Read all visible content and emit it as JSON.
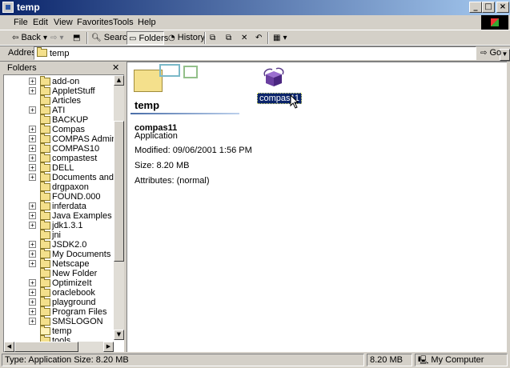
{
  "window": {
    "title": "temp"
  },
  "menu": [
    "File",
    "Edit",
    "View",
    "Favorites",
    "Tools",
    "Help"
  ],
  "toolbar": {
    "back_label": "Back",
    "search_label": "Search",
    "folders_label": "Folders",
    "history_label": "History"
  },
  "address": {
    "label": "Address",
    "value": "temp",
    "go_label": "Go"
  },
  "folders_pane": {
    "title": "Folders",
    "items": [
      {
        "label": "add-on",
        "expandable": true
      },
      {
        "label": "AppletStuff",
        "expandable": true
      },
      {
        "label": "Articles",
        "expandable": false
      },
      {
        "label": "ATI",
        "expandable": true
      },
      {
        "label": "BACKUP",
        "expandable": false
      },
      {
        "label": "Compas",
        "expandable": true
      },
      {
        "label": "COMPAS Administration",
        "expandable": true
      },
      {
        "label": "COMPAS10",
        "expandable": true
      },
      {
        "label": "compastest",
        "expandable": true
      },
      {
        "label": "DELL",
        "expandable": true
      },
      {
        "label": "Documents and Settings",
        "expandable": true
      },
      {
        "label": "drgpaxon",
        "expandable": false
      },
      {
        "label": "FOUND.000",
        "expandable": false
      },
      {
        "label": "inferdata",
        "expandable": true
      },
      {
        "label": "Java Examples",
        "expandable": true
      },
      {
        "label": "jdk1.3.1",
        "expandable": true
      },
      {
        "label": "jni",
        "expandable": false
      },
      {
        "label": "JSDK2.0",
        "expandable": true
      },
      {
        "label": "My Documents",
        "expandable": true
      },
      {
        "label": "Netscape",
        "expandable": true
      },
      {
        "label": "New Folder",
        "expandable": false
      },
      {
        "label": "OptimizeIt",
        "expandable": true
      },
      {
        "label": "oraclebook",
        "expandable": true
      },
      {
        "label": "playground",
        "expandable": true
      },
      {
        "label": "Program Files",
        "expandable": true
      },
      {
        "label": "SMSLOGON",
        "expandable": true
      },
      {
        "label": "temp",
        "expandable": false
      },
      {
        "label": "tools",
        "expandable": false
      }
    ]
  },
  "info_panel": {
    "folder_title": "temp",
    "item_name": "compas11",
    "item_type": "Application",
    "modified": "Modified: 09/06/2001 1:56 PM",
    "size": "Size: 8.20 MB",
    "attributes": "Attributes: (normal)"
  },
  "files": [
    {
      "name": "compas11",
      "icon": "application-icon",
      "selected": true
    }
  ],
  "status": {
    "text": "Type: Application Size: 8.20 MB",
    "size": "8.20 MB",
    "zone": "My Computer"
  },
  "colors": {
    "titlebar": "#0a246a",
    "selection": "#0a246a",
    "chrome": "#d4d0c8"
  }
}
